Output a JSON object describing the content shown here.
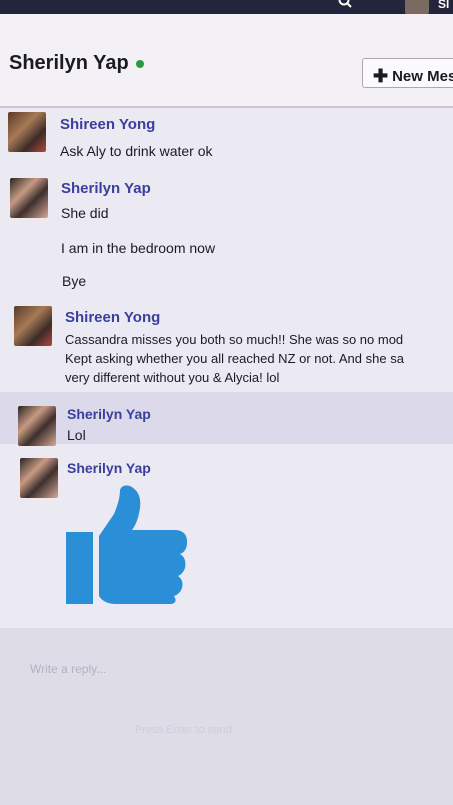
{
  "topbar": {
    "user_short": "Sl"
  },
  "header": {
    "title": "Sherilyn Yap",
    "new_message_label": "New Mes"
  },
  "messages": [
    {
      "sender": "Shireen Yong",
      "lines": [
        "Ask Aly to drink water ok"
      ]
    },
    {
      "sender": "Sherilyn Yap",
      "lines": [
        "She did",
        "I am in the bedroom now",
        "Bye"
      ]
    },
    {
      "sender": "Shireen Yong",
      "lines": [
        "Cassandra misses you both so much!!  She was so no mod",
        "Kept asking whether you all reached NZ or not.  And she sa",
        "very different without you & Alycia! lol"
      ]
    },
    {
      "sender": "Sherilyn Yap",
      "lines": [
        "Lol"
      ]
    },
    {
      "sender": "Sherilyn Yap",
      "sticker": "thumbs-up"
    }
  ],
  "composer": {
    "placeholder": "Write a reply...",
    "hint": "Press Enter to send"
  },
  "colors": {
    "accent": "#3a3f9e",
    "online": "#2a9a3e",
    "like": "#2a8fd6"
  }
}
